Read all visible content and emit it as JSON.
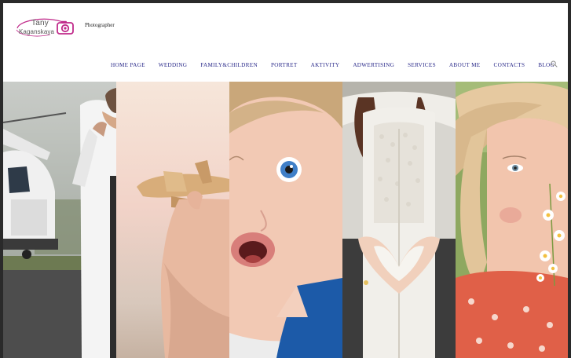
{
  "logo": {
    "line1": "Tany",
    "line2": "Kaganskaya"
  },
  "tagline": "Photographer",
  "nav": {
    "items": [
      {
        "label": "HOME PAGE"
      },
      {
        "label": "WEDDING"
      },
      {
        "label": "FAMILY&CHILDREN"
      },
      {
        "label": "PORTRET"
      },
      {
        "label": "AKTIVITY"
      },
      {
        "label": "ADWERTISING"
      },
      {
        "label": "SERVICES"
      },
      {
        "label": "ABOUT ME"
      },
      {
        "label": "CONTACTS"
      },
      {
        "label": "BLOG"
      }
    ]
  },
  "colors": {
    "nav_text": "#2a2a8a",
    "logo_accent": "#c02a8a",
    "frame": "#2a2a2a"
  },
  "icons": [
    "camera-icon",
    "search-icon"
  ]
}
